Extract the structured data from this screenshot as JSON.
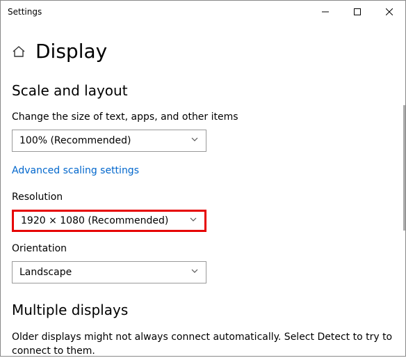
{
  "window": {
    "title": "Settings"
  },
  "header": {
    "page_title": "Display"
  },
  "sections": {
    "scale_layout": {
      "heading": "Scale and layout",
      "text_size": {
        "label": "Change the size of text, apps, and other items",
        "value": "100% (Recommended)"
      },
      "advanced_link": "Advanced scaling settings",
      "resolution": {
        "label": "Resolution",
        "value": "1920 × 1080 (Recommended)"
      },
      "orientation": {
        "label": "Orientation",
        "value": "Landscape"
      }
    },
    "multiple_displays": {
      "heading": "Multiple displays",
      "description": "Older displays might not always connect automatically. Select Detect to try to connect to them."
    }
  }
}
